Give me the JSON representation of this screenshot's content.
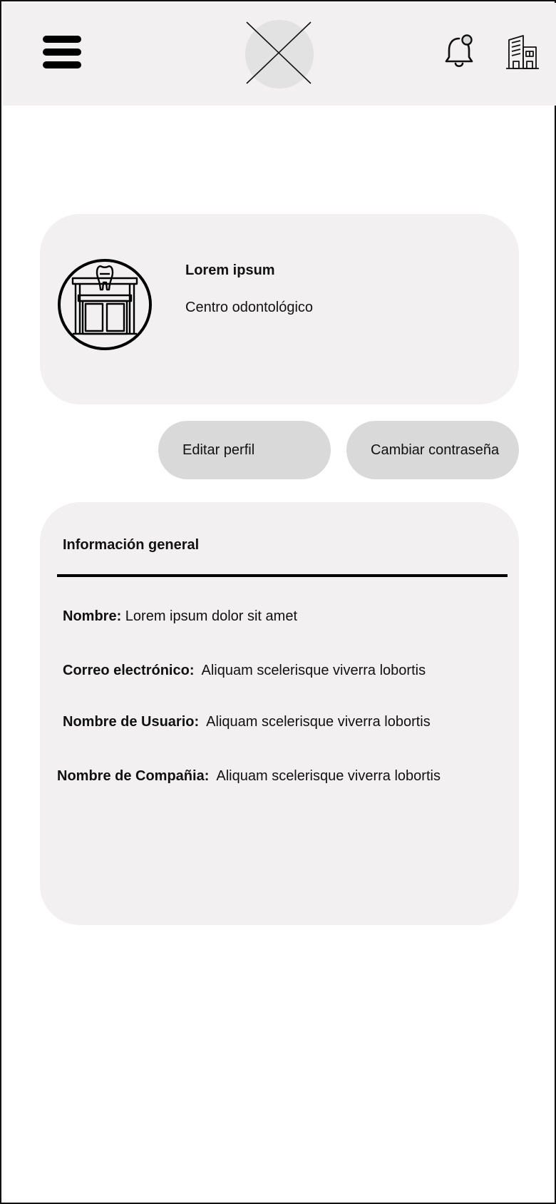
{
  "header": {
    "menu_icon": "hamburger-menu-icon",
    "logo_icon": "logo-placeholder-icon",
    "notification_icon": "bell-icon",
    "company_icon": "building-icon"
  },
  "profile": {
    "avatar_icon": "dental-clinic-icon",
    "name": "Lorem ipsum",
    "type": "Centro odontológico"
  },
  "actions": {
    "edit_label": "Editar perfil",
    "change_password_label": "Cambiar contraseña"
  },
  "info": {
    "title": "Información general",
    "nombre_label": "Nombre:",
    "nombre_value": "Lorem ipsum dolor sit amet",
    "correo_label": "Correo electrónico:",
    "correo_value": "Aliquam scelerisque viverra lobortis",
    "usuario_label": "Nombre de Usuario:",
    "usuario_value": "Aliquam scelerisque viverra lobortis",
    "compania_label": "Nombre de Compañia:",
    "compania_value": "Aliquam scelerisque viverra lobortis"
  }
}
